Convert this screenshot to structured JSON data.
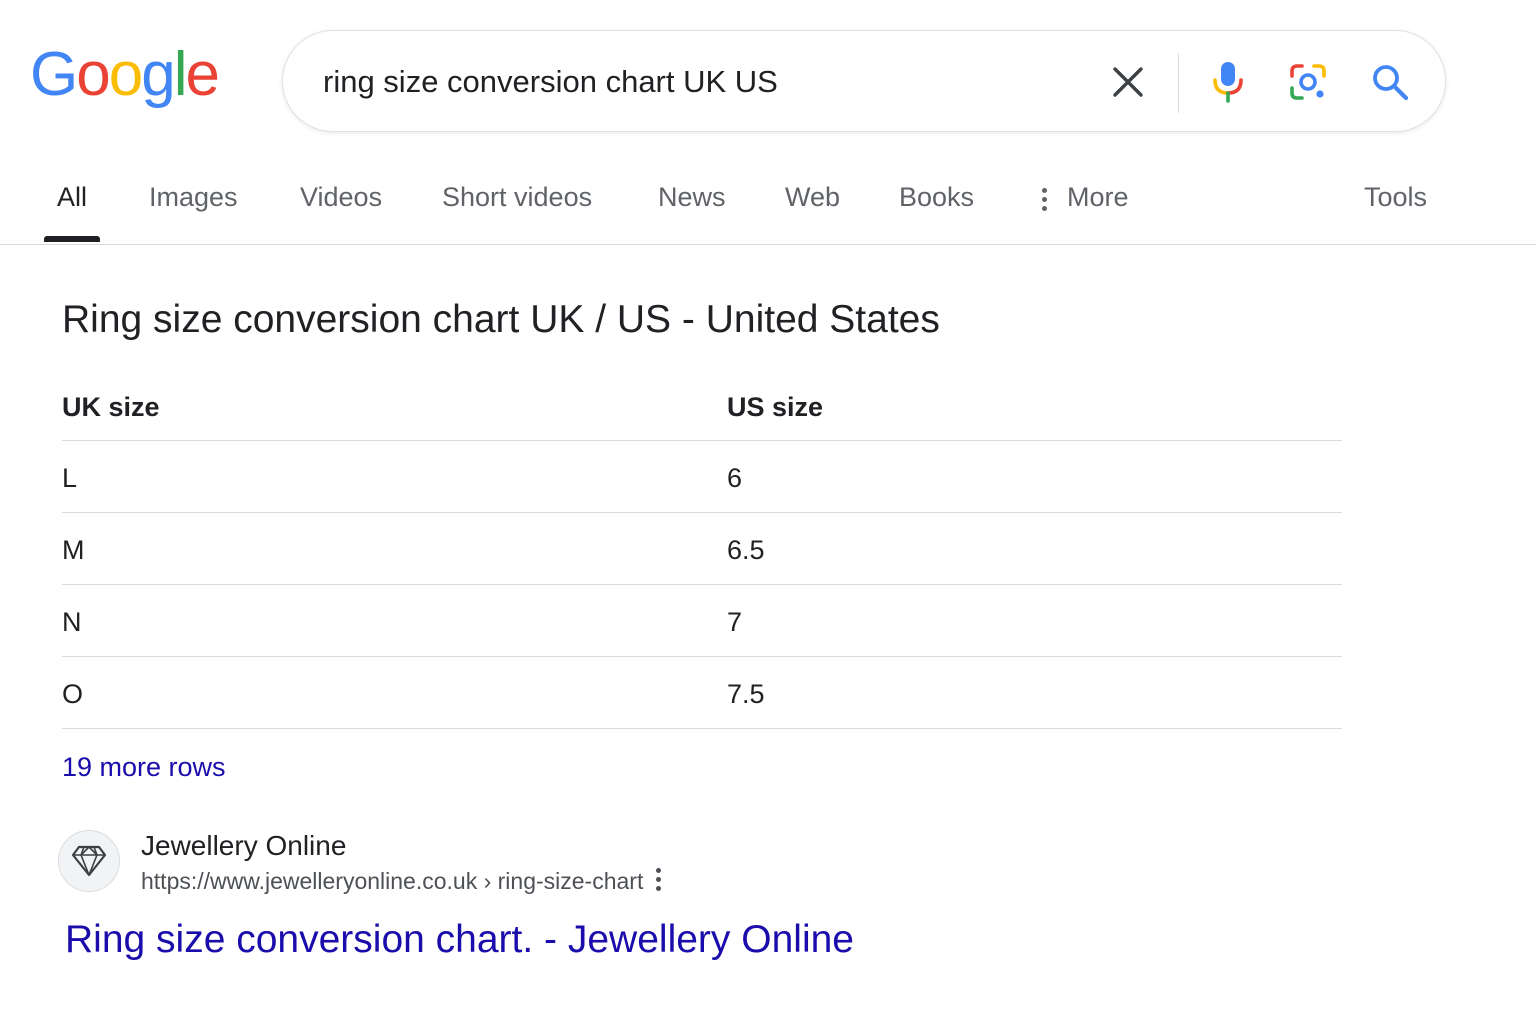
{
  "logo": {
    "letters": [
      "G",
      "o",
      "o",
      "g",
      "l",
      "e"
    ],
    "colors": [
      "#4285F4",
      "#EA4335",
      "#FBBC05",
      "#4285F4",
      "#34A853",
      "#EA4335"
    ]
  },
  "search": {
    "query": "ring size conversion chart UK US",
    "icons": [
      "close-icon",
      "mic-icon",
      "lens-icon",
      "search-icon"
    ]
  },
  "tabs": [
    {
      "label": "All",
      "active": true
    },
    {
      "label": "Images"
    },
    {
      "label": "Videos"
    },
    {
      "label": "Short videos"
    },
    {
      "label": "News"
    },
    {
      "label": "Web"
    },
    {
      "label": "Books"
    },
    {
      "label": "More",
      "icon": "more-vert-icon"
    },
    {
      "label": "Tools"
    }
  ],
  "snippet": {
    "title": "Ring size conversion chart UK / US - United States",
    "headers": [
      "UK size",
      "US size"
    ],
    "rows": [
      [
        "L",
        "6"
      ],
      [
        "M",
        "6.5"
      ],
      [
        "N",
        "7"
      ],
      [
        "O",
        "7.5"
      ]
    ],
    "more_rows": "19 more rows"
  },
  "result": {
    "site_name": "Jewellery Online",
    "url": "https://www.jewelleryonline.co.uk › ring-size-chart",
    "title": "Ring size conversion chart. - Jewellery Online",
    "favicon": "diamond-icon"
  },
  "colors": {
    "link": "#1a0dab",
    "text": "#202124",
    "secondary": "#5f6368"
  }
}
